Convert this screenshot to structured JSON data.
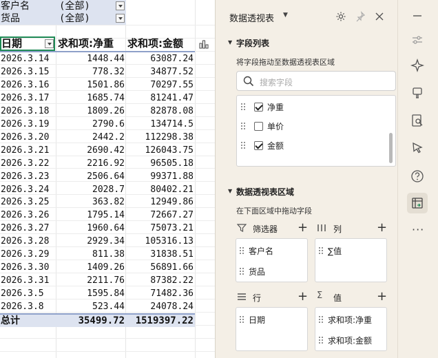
{
  "filters": [
    {
      "label": "客户名",
      "value": "(全部)"
    },
    {
      "label": "货品",
      "value": "(全部)"
    }
  ],
  "table": {
    "headers": [
      "日期",
      "求和项:净重",
      "求和项:金额"
    ],
    "rows": [
      [
        "2026.3.14",
        "1448.44",
        "63087.24"
      ],
      [
        "2026.3.15",
        "778.32",
        "34877.52"
      ],
      [
        "2026.3.16",
        "1501.86",
        "70297.55"
      ],
      [
        "2026.3.17",
        "1685.74",
        "81241.47"
      ],
      [
        "2026.3.18",
        "1809.26",
        "82878.08"
      ],
      [
        "2026.3.19",
        "2790.6",
        "134714.5"
      ],
      [
        "2026.3.20",
        "2442.2",
        "112298.38"
      ],
      [
        "2026.3.21",
        "2690.42",
        "126043.75"
      ],
      [
        "2026.3.22",
        "2216.92",
        "96505.18"
      ],
      [
        "2026.3.23",
        "2506.64",
        "99371.88"
      ],
      [
        "2026.3.24",
        "2028.7",
        "80402.21"
      ],
      [
        "2026.3.25",
        "363.82",
        "12949.86"
      ],
      [
        "2026.3.26",
        "1795.14",
        "72667.27"
      ],
      [
        "2026.3.27",
        "1960.64",
        "75073.21"
      ],
      [
        "2026.3.28",
        "2929.34",
        "105316.13"
      ],
      [
        "2026.3.29",
        "811.38",
        "31838.51"
      ],
      [
        "2026.3.30",
        "1409.26",
        "56891.66"
      ],
      [
        "2026.3.31",
        "2211.76",
        "87382.22"
      ],
      [
        "2026.3.5",
        "1595.84",
        "71482.36"
      ],
      [
        "2026.3.8",
        "523.44",
        "24078.24"
      ]
    ],
    "total": {
      "label": "总计",
      "weight": "35499.72",
      "amount": "1519397.22"
    }
  },
  "panel": {
    "title": "数据透视表",
    "field_list": {
      "title": "字段列表",
      "hint": "将字段拖动至数据透视表区域",
      "search_placeholder": "搜索字段",
      "fields": [
        {
          "label": "净重",
          "checked": true
        },
        {
          "label": "单价",
          "checked": false
        },
        {
          "label": "金额",
          "checked": true
        }
      ]
    },
    "areas": {
      "title": "数据透视表区域",
      "hint": "在下面区域中拖动字段",
      "filters": {
        "label": "筛选器",
        "items": [
          "客户名",
          "货品"
        ]
      },
      "columns": {
        "label": "列",
        "items": [
          "∑值"
        ]
      },
      "rows": {
        "label": "行",
        "items": [
          "日期"
        ]
      },
      "values": {
        "label": "值",
        "items": [
          "求和项:净重",
          "求和项:金额"
        ]
      }
    }
  },
  "colors": {
    "header_band": "#dde3f0",
    "header_line": "#8ea0c9",
    "selection": "#1e8a55",
    "panel_bg": "#f4efe6"
  },
  "toolbar_icons": [
    "minimize-icon",
    "sliders-icon",
    "sparkle-icon",
    "format-brush-icon",
    "search-doc-icon",
    "pointer-icon",
    "help-icon",
    "pivot-table-icon",
    "more-icon"
  ]
}
